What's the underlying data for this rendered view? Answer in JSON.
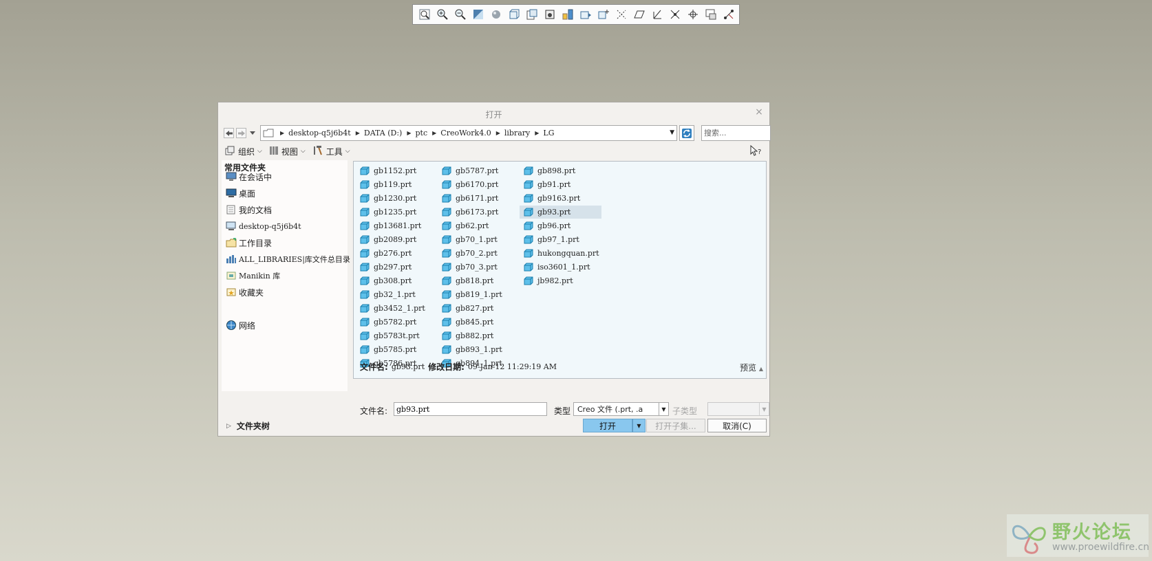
{
  "dialog": {
    "title": "打开",
    "close_glyph": "×"
  },
  "address": {
    "crumbs": [
      "desktop-q5j6b4t",
      "DATA (D:)",
      "ptc",
      "CreoWork4.0",
      "library",
      "LG"
    ],
    "search_placeholder": "搜索..."
  },
  "toolbar": {
    "organize": "组织",
    "view": "视图",
    "tools": "工具"
  },
  "favorites": {
    "header": "常用文件夹",
    "items": [
      {
        "label": "在会话中",
        "icon": "session-icon"
      },
      {
        "label": "桌面",
        "icon": "desktop-icon"
      },
      {
        "label": "我的文档",
        "icon": "documents-icon"
      },
      {
        "label": "desktop-q5j6b4t",
        "icon": "computer-icon"
      },
      {
        "label": "工作目录",
        "icon": "working-directory-icon"
      },
      {
        "label": "ALL_LIBRARIES|库文件总目录",
        "icon": "library-icon"
      },
      {
        "label": "Manikin 库",
        "icon": "manikin-library-icon"
      },
      {
        "label": "收藏夹",
        "icon": "favorites-folder-icon"
      },
      {
        "label": "网络",
        "icon": "network-icon"
      }
    ],
    "folder_tree": "文件夹树"
  },
  "files": {
    "columns": [
      [
        "gb1152.prt",
        "gb119.prt",
        "gb1230.prt",
        "gb1235.prt",
        "gb13681.prt",
        "gb2089.prt",
        "gb276.prt",
        "gb297.prt",
        "gb308.prt",
        "gb32_1.prt",
        "gb3452_1.prt",
        "gb5782.prt",
        "gb5783t.prt",
        "gb5785.prt",
        "gb5786.prt"
      ],
      [
        "gb5787.prt",
        "gb6170.prt",
        "gb6171.prt",
        "gb6173.prt",
        "gb62.prt",
        "gb70_1.prt",
        "gb70_2.prt",
        "gb70_3.prt",
        "gb818.prt",
        "gb819_1.prt",
        "gb827.prt",
        "gb845.prt",
        "gb882.prt",
        "gb893_1.prt",
        "gb894_1.prt"
      ],
      [
        "gb898.prt",
        "gb91.prt",
        "gb9163.prt",
        "gb93.prt",
        "gb96.prt",
        "gb97_1.prt",
        "hukongquan.prt",
        "iso3601_1.prt",
        "jb982.prt"
      ]
    ],
    "selected": "gb93.prt"
  },
  "details": {
    "name_label": "文件名:",
    "name_value": "gb93.prt",
    "date_label": "修改日期:",
    "date_value": "09-Jan-12 11:29:19 AM",
    "preview": "预览"
  },
  "bottom": {
    "filename_label": "文件名:",
    "filename_value": "gb93.prt",
    "type_label": "类型",
    "type_value": "Creo 文件 (.prt, .a",
    "subtype_label": "子类型",
    "open": "打开",
    "open_subset": "打开子集...",
    "cancel": "取消(C)"
  },
  "watermark": {
    "name": "野火论坛",
    "url": "www.proewildfire.cn"
  },
  "colors": {
    "open_button": "#89c7ee",
    "file_icon": "#3da9d9",
    "list_bg": "#f1f8fb",
    "selected_row": "#d6e2ea"
  }
}
